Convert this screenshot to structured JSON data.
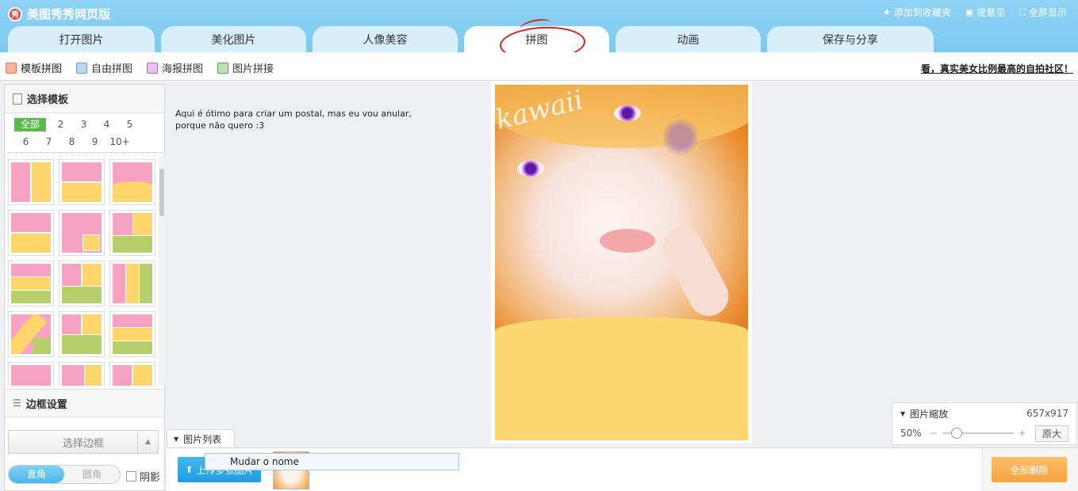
{
  "app": {
    "title": "美图秀秀网页版"
  },
  "top_links": [
    {
      "icon": "star-icon",
      "label": "添加到收藏夹"
    },
    {
      "icon": "comment-icon",
      "label": "提意见"
    },
    {
      "icon": "fullscreen-icon",
      "label": "全屏显示"
    }
  ],
  "tabs": [
    {
      "label": "打开图片"
    },
    {
      "label": "美化图片"
    },
    {
      "label": "人像美容"
    },
    {
      "label": "拼图"
    },
    {
      "label": "动画"
    },
    {
      "label": "保存与分享"
    }
  ],
  "subtabs": [
    {
      "label": "模板拼图",
      "color": "#f08a6e"
    },
    {
      "label": "自由拼图",
      "color": "#5a9fd8"
    },
    {
      "label": "海报拼图",
      "color": "#c47fd1"
    },
    {
      "label": "图片拼接",
      "color": "#55b54a"
    }
  ],
  "promo": "看，真实美女比例最高的自拍社区！",
  "left_panel": {
    "template_title": "选择模板",
    "filters": [
      "全部",
      "2",
      "3",
      "4",
      "5",
      "6",
      "7",
      "8",
      "9",
      "10+"
    ],
    "border_title": "边框设置",
    "border_select": "选择边框",
    "corner_square": "直角",
    "corner_round": "圆角",
    "shadow": "阴影"
  },
  "note": "Aqui é ótimo para criar um postal, mas eu vou anular, porque não quero :3",
  "photo_text": "kawaii",
  "zoom": {
    "title": "图片缩放",
    "dimensions": "657x917",
    "percent": "50%",
    "minus": "−",
    "plus": "+",
    "original": "原大",
    "level": 0.2
  },
  "bottom": {
    "list_tab": "图片列表",
    "upload": "上传多张图片",
    "tooltip": "Mudar o nome",
    "delete_all": "全部删除"
  },
  "colors": {
    "pink": "#f7a1c3",
    "yellow": "#fdd56b",
    "green": "#b7cf6b",
    "accent": "#7ccaf0"
  }
}
